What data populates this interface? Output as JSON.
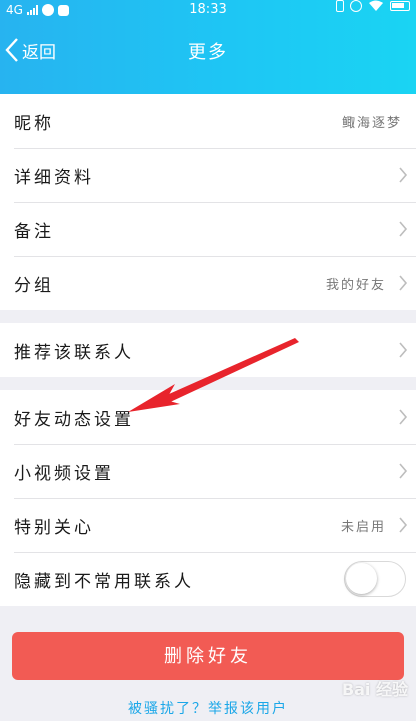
{
  "status_bar": {
    "network": "4G",
    "time": "18:33"
  },
  "nav": {
    "back_label": "返回",
    "title": "更多"
  },
  "profile_group": [
    {
      "label": "昵称",
      "value": "鲰海逐梦",
      "chevron": false
    },
    {
      "label": "详细资料",
      "value": "",
      "chevron": true
    },
    {
      "label": "备注",
      "value": "",
      "chevron": true
    },
    {
      "label": "分组",
      "value": "我的好友",
      "chevron": true
    }
  ],
  "recommend_group": [
    {
      "label": "推荐该联系人",
      "value": "",
      "chevron": true
    }
  ],
  "settings_group": [
    {
      "label": "好友动态设置",
      "value": "",
      "chevron": true
    },
    {
      "label": "小视频设置",
      "value": "",
      "chevron": true
    },
    {
      "label": "特别关心",
      "value": "未启用",
      "chevron": true
    },
    {
      "label": "隐藏到不常用联系人",
      "value": "",
      "toggle": false
    }
  ],
  "delete_button": "删除好友",
  "report_link": "被骚扰了？举报该用户",
  "watermark": "Bai 经验",
  "colors": {
    "header_gradient_start": "#27b3f0",
    "header_gradient_end": "#1ad4f3",
    "delete_red": "#f25b54",
    "link_blue": "#1ba7e8",
    "annotation_red": "#e8242c"
  }
}
